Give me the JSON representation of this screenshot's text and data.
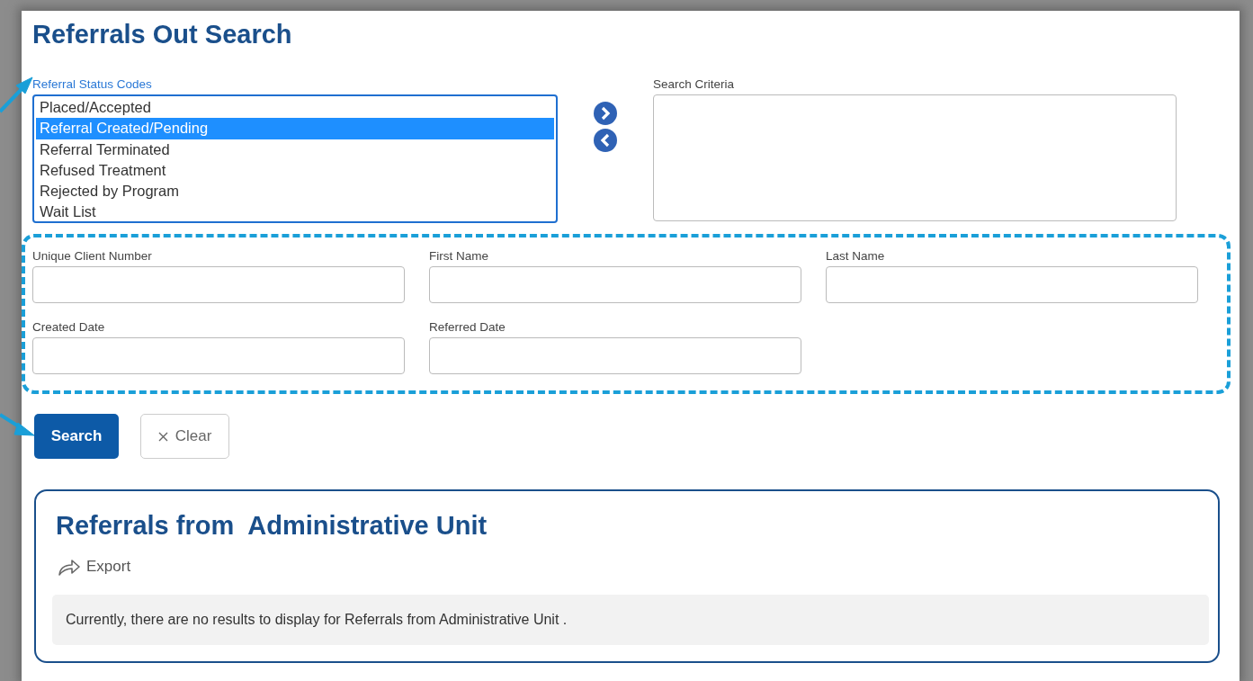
{
  "page_title": "Referrals Out Search",
  "status_codes": {
    "label": "Referral Status Codes",
    "options": [
      {
        "label": "Placed/Accepted",
        "selected": false
      },
      {
        "label": "Referral Created/Pending",
        "selected": true
      },
      {
        "label": "Referral Terminated",
        "selected": false
      },
      {
        "label": "Refused Treatment",
        "selected": false
      },
      {
        "label": "Rejected by Program",
        "selected": false
      },
      {
        "label": "Wait List",
        "selected": false
      }
    ]
  },
  "search_criteria": {
    "label": "Search Criteria"
  },
  "fields": [
    {
      "label": "Unique Client Number"
    },
    {
      "label": "First Name"
    },
    {
      "label": "Last Name"
    },
    {
      "label": "Created Date"
    },
    {
      "label": "Referred Date"
    }
  ],
  "buttons": [
    {
      "kind": "primary",
      "label": "Search"
    },
    {
      "kind": "clear",
      "label": "Clear"
    }
  ],
  "results": {
    "title": "Referrals from  Administrative Unit",
    "export": "Export",
    "message": "Currently, there are no results to display for Referrals from Administrative Unit ."
  }
}
